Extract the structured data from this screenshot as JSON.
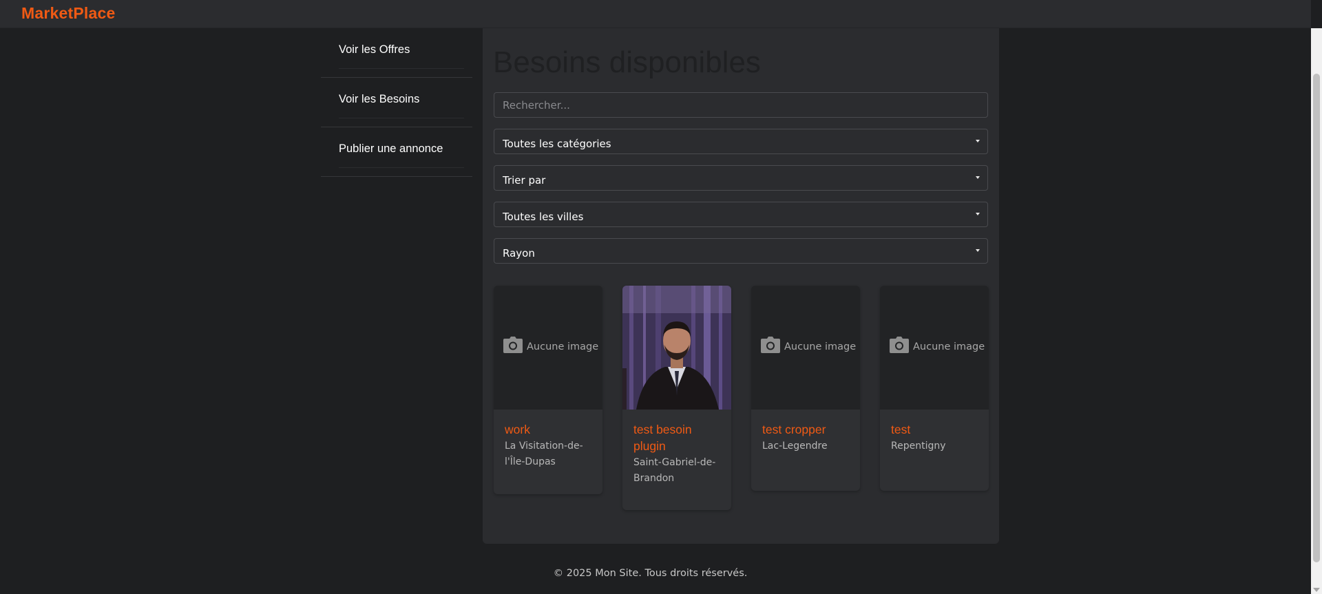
{
  "header": {
    "brand": "MarketPlace",
    "brand_color": "#f05a14"
  },
  "sidebar": {
    "items": [
      {
        "label": "Voir les Offres"
      },
      {
        "label": "Voir les Besoins"
      },
      {
        "label": "Publier une annonce"
      }
    ]
  },
  "main": {
    "title": "Besoins disponibles",
    "search": {
      "placeholder": "Rechercher...",
      "value": ""
    },
    "filters": {
      "category": "Toutes les catégories",
      "sort": "Trier par",
      "city": "Toutes les villes",
      "radius": "Rayon"
    },
    "cards": [
      {
        "title": "work",
        "city": "La Visitation-de-l'Île-Dupas",
        "image": "none",
        "no_image_label": "Aucune image",
        "icon": "camera-icon"
      },
      {
        "title": "test besoin plugin",
        "city": "Saint-Gabriel-de-Brandon",
        "image": "photo"
      },
      {
        "title": "test cropper",
        "city": "Lac-Legendre",
        "image": "none",
        "no_image_label": "Aucune image",
        "icon": "camera-icon"
      },
      {
        "title": "test",
        "city": "Repentigny",
        "image": "none",
        "no_image_label": "Aucune image",
        "icon": "camera-icon"
      }
    ]
  },
  "footer": {
    "text": "© 2025 Mon Site. Tous droits réservés."
  }
}
